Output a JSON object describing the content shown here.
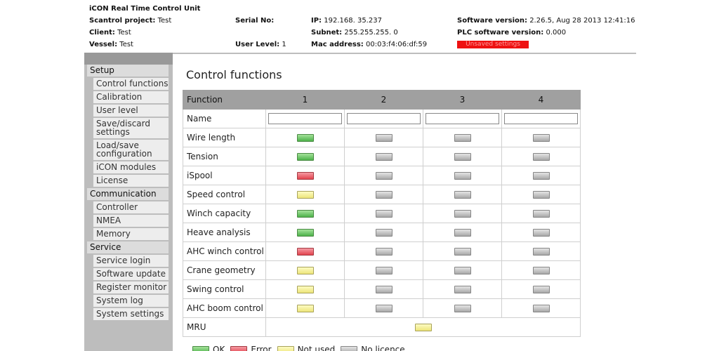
{
  "header": {
    "app_title": "iCON Real Time Control Unit",
    "project_label": "Scantrol project:",
    "project_value": "Test",
    "client_label": "Client:",
    "client_value": "Test",
    "vessel_label": "Vessel:",
    "vessel_value": "Test",
    "serial_label": "Serial No:",
    "serial_value": "",
    "user_level_label": "User Level:",
    "user_level_value": "1",
    "ip_label": "IP:",
    "ip_value": "192.168. 35.237",
    "subnet_label": "Subnet:",
    "subnet_value": "255.255.255. 0",
    "mac_label": "Mac address:",
    "mac_value": "00:03:f4:06:df:59",
    "sw_label": "Software version:",
    "sw_value": "2.26.5, Aug 28 2013 12:41:16",
    "plc_label": "PLC software version:",
    "plc_value": "0.000",
    "unsaved_text": "Unsaved settings",
    "unsaved_color": "#ee1111"
  },
  "sidebar": {
    "sections": [
      {
        "heading": "Setup",
        "items": [
          "Control functions",
          "Calibration",
          "User level",
          "Save/discard settings",
          "Load/save configuration",
          "iCON modules",
          "License"
        ]
      },
      {
        "heading": "Communication",
        "items": [
          "Controller",
          "NMEA",
          "Memory"
        ]
      },
      {
        "heading": "Service",
        "items": [
          "Service login",
          "Software update",
          "Register monitor",
          "System log",
          "System settings"
        ]
      }
    ]
  },
  "main": {
    "title": "Control functions",
    "table": {
      "function_header": "Function",
      "columns": [
        "1",
        "2",
        "3",
        "4"
      ],
      "name_label": "Name",
      "name_values": [
        "",
        "",
        "",
        ""
      ],
      "rows": [
        {
          "label": "Wire length",
          "states": [
            "green",
            "grey",
            "grey",
            "grey"
          ]
        },
        {
          "label": "Tension",
          "states": [
            "green",
            "grey",
            "grey",
            "grey"
          ]
        },
        {
          "label": "iSpool",
          "states": [
            "red",
            "grey",
            "grey",
            "grey"
          ]
        },
        {
          "label": "Speed control",
          "states": [
            "yellow",
            "grey",
            "grey",
            "grey"
          ]
        },
        {
          "label": "Winch capacity",
          "states": [
            "green",
            "grey",
            "grey",
            "grey"
          ]
        },
        {
          "label": "Heave analysis",
          "states": [
            "green",
            "grey",
            "grey",
            "grey"
          ]
        },
        {
          "label": "AHC winch control",
          "states": [
            "red",
            "grey",
            "grey",
            "grey"
          ]
        },
        {
          "label": "Crane geometry",
          "states": [
            "yellow",
            "grey",
            "grey",
            "grey"
          ]
        },
        {
          "label": "Swing control",
          "states": [
            "yellow",
            "grey",
            "grey",
            "grey"
          ]
        },
        {
          "label": "AHC boom control",
          "states": [
            "yellow",
            "grey",
            "grey",
            "grey"
          ]
        }
      ],
      "mru_row": {
        "label": "MRU",
        "state": "yellow"
      }
    },
    "legend": [
      {
        "state": "green",
        "label": "OK"
      },
      {
        "state": "red",
        "label": "Error"
      },
      {
        "state": "yellow",
        "label": "Not used"
      },
      {
        "state": "grey",
        "label": "No licence"
      }
    ]
  },
  "colors": {
    "green": "#4db24a",
    "red": "#e2434e",
    "yellow": "#ede57a",
    "grey": "#a8a8a8",
    "table_header": "#a0a0a0",
    "sidebar_bg": "#bdbdbd"
  }
}
